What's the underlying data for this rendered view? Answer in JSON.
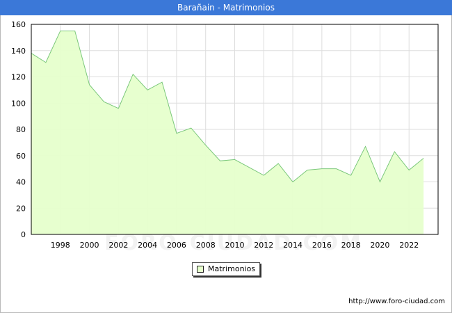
{
  "chart_data": {
    "type": "area",
    "title": "Barañain - Matrimonios",
    "x": [
      1996,
      1997,
      1998,
      1999,
      2000,
      2001,
      2002,
      2003,
      2004,
      2005,
      2006,
      2007,
      2008,
      2009,
      2010,
      2011,
      2012,
      2013,
      2014,
      2015,
      2016,
      2017,
      2018,
      2019,
      2020,
      2021,
      2022,
      2023
    ],
    "series": [
      {
        "name": "Matrimonios",
        "values": [
          138,
          131,
          155,
          155,
          114,
          101,
          96,
          122,
          110,
          116,
          77,
          81,
          68,
          56,
          57,
          51,
          45,
          54,
          40,
          49,
          50,
          50,
          45,
          67,
          40,
          63,
          49,
          58
        ]
      }
    ],
    "xticks": [
      1998,
      2000,
      2002,
      2004,
      2006,
      2008,
      2010,
      2012,
      2014,
      2016,
      2018,
      2020,
      2022
    ],
    "yticks": [
      0,
      20,
      40,
      60,
      80,
      100,
      120,
      140,
      160
    ],
    "xlim": [
      1996,
      2024
    ],
    "ylim": [
      0,
      160
    ],
    "grid": true,
    "legend_position": "bottom-center",
    "fill_color": "#e6ffcc",
    "line_color": "#7bc87b"
  },
  "footer": {
    "source_url": "http://www.foro-ciudad.com",
    "watermark": "FORO-CIUDAD.COM"
  }
}
